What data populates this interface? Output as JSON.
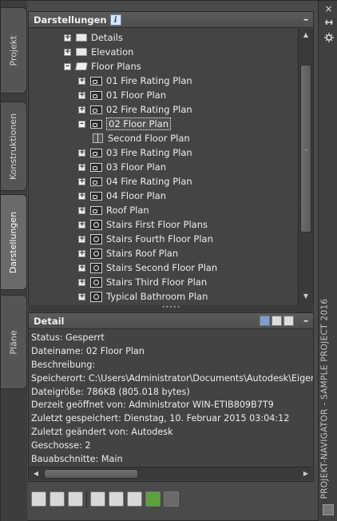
{
  "left_tabs": [
    "Projekt",
    "Konstruktionen",
    "Darstellungen",
    "Pläne"
  ],
  "rail": {
    "close": "×",
    "title": "PROJEKT-NAVIGATOR - SAMPLE PROJECT 2016"
  },
  "views_panel": {
    "title": "Darstellungen",
    "info_icon": "i",
    "minimize": "–"
  },
  "tree": [
    {
      "label": "Details",
      "exp": "+",
      "icon": "folder"
    },
    {
      "label": "Elevation",
      "exp": "+",
      "icon": "folder"
    },
    {
      "label": "Floor Plans",
      "exp": "–",
      "icon": "folder-open"
    },
    {
      "label": "01 Fire Rating Plan",
      "exp": "+",
      "icon": "view"
    },
    {
      "label": "01 Floor Plan",
      "exp": "+",
      "icon": "view"
    },
    {
      "label": "02 Fire Rating Plan",
      "exp": "+",
      "icon": "view"
    },
    {
      "label": "02 Floor Plan",
      "exp": "–",
      "icon": "view",
      "selected": true
    },
    {
      "label": "Second Floor Plan",
      "exp": "",
      "icon": "plan"
    },
    {
      "label": "03 Fire Rating Plan",
      "exp": "+",
      "icon": "view"
    },
    {
      "label": "03 Floor Plan",
      "exp": "+",
      "icon": "view"
    },
    {
      "label": "04 Fire Rating Plan",
      "exp": "+",
      "icon": "view"
    },
    {
      "label": "04 Floor Plan",
      "exp": "+",
      "icon": "view"
    },
    {
      "label": "Roof Plan",
      "exp": "+",
      "icon": "view"
    },
    {
      "label": "Stairs First Floor Plans",
      "exp": "+",
      "icon": "stair"
    },
    {
      "label": "Stairs Fourth Floor Plan",
      "exp": "+",
      "icon": "stair"
    },
    {
      "label": "Stairs Roof Plan",
      "exp": "+",
      "icon": "stair"
    },
    {
      "label": "Stairs Second Floor Plan",
      "exp": "+",
      "icon": "stair"
    },
    {
      "label": "Stairs Third Floor Plan",
      "exp": "+",
      "icon": "stair"
    },
    {
      "label": "Typical Bathroom Plan",
      "exp": "+",
      "icon": "stair"
    }
  ],
  "detail_panel": {
    "title": "Detail",
    "minimize": "–",
    "lines": [
      "Status: Gesperrt",
      "Dateiname: 02 Floor Plan",
      "Beschreibung:",
      "Speicherort: C:\\Users\\Administrator\\Documents\\Autodesk\\Eigene",
      "Dateigröße: 786KB (805.018 bytes)",
      "Derzeit geöffnet von: Administrator WIN-ETIB809B7T9",
      "Zuletzt gespeichert: Dienstag, 10. Februar 2015  03:04:12",
      "Zuletzt geändert von: Autodesk",
      "Geschosse: 2",
      "Bauabschnitte: Main"
    ]
  }
}
